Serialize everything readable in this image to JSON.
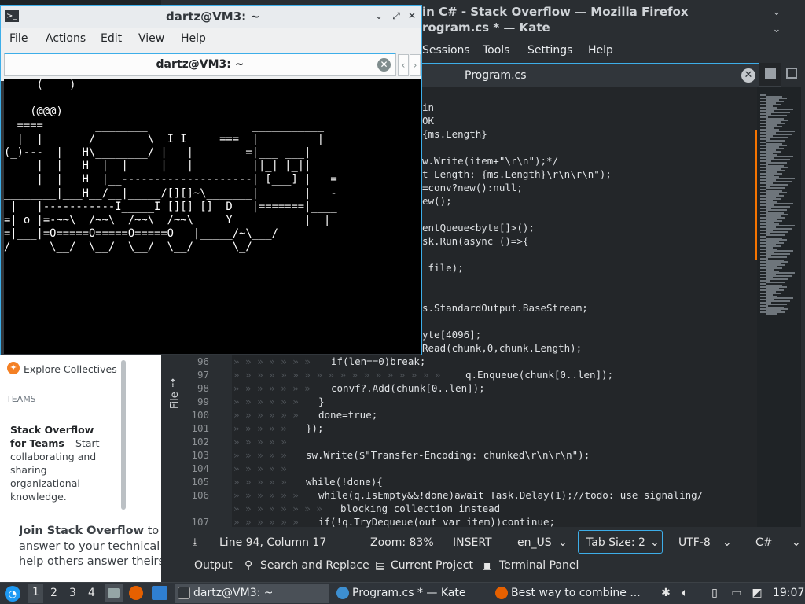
{
  "kate": {
    "title_line1": "in C# - Stack Overflow — Mozilla Firefox",
    "title_line2": "rogram.cs * — Kate",
    "menu": [
      "Sessions",
      "Tools",
      "Settings",
      "Help"
    ],
    "tab_label": "Program.cs",
    "side_tab": "File",
    "code_lines": [
      {
        "n": "",
        "t": "in"
      },
      {
        "n": "",
        "t": "OK"
      },
      {
        "n": "",
        "t": "{ms.Length}"
      },
      {
        "n": "",
        "t": ""
      },
      {
        "n": "",
        "t": "w.Write(item+\"\\r\\n\");*/"
      },
      {
        "n": "",
        "t": "t-Length: {ms.Length}\\r\\n\\r\\n\");"
      },
      {
        "n": "",
        "t": "=conv?new():null;"
      },
      {
        "n": "",
        "t": "ew();"
      },
      {
        "n": "",
        "t": ""
      },
      {
        "n": "",
        "t": "entQueue<byte[]>();"
      },
      {
        "n": "",
        "t": "sk.Run(async ()=>{"
      },
      {
        "n": "",
        "t": ""
      },
      {
        "n": "",
        "t": " file);"
      },
      {
        "n": "",
        "t": ""
      },
      {
        "n": "",
        "t": ""
      },
      {
        "n": "",
        "t": "s.StandardOutput.BaseStream;"
      },
      {
        "n": "",
        "t": ""
      },
      {
        "n": "",
        "t": "yte[4096];"
      },
      {
        "n": "",
        "t": "Read(chunk,0,chunk.Length);"
      }
    ],
    "numbered_lines": [
      {
        "n": "96",
        "t": "if(len==0)break;"
      },
      {
        "n": "97",
        "t": "q.Enqueue(chunk[0..len]);"
      },
      {
        "n": "98",
        "t": "convf?.Add(chunk[0..len]);"
      },
      {
        "n": "99",
        "t": "}"
      },
      {
        "n": "100",
        "t": "done=true;"
      },
      {
        "n": "101",
        "t": "});"
      },
      {
        "n": "102",
        "t": ""
      },
      {
        "n": "103",
        "t": "sw.Write($\"Transfer-Encoding: chunked\\r\\n\\r\\n\");"
      },
      {
        "n": "104",
        "t": ""
      },
      {
        "n": "105",
        "t": "while(!done){"
      },
      {
        "n": "106",
        "t": "while(q.IsEmpty&&!done)await Task.Delay(1);//todo: use signaling/"
      },
      {
        "n": "",
        "t": "blocking collection instead"
      },
      {
        "n": "107",
        "t": "if(!q.TryDequeue(out var item))continue;"
      }
    ],
    "status": {
      "position": "Line 94, Column 17",
      "zoom": "Zoom: 83%",
      "mode": "INSERT",
      "dictionary": "en_US",
      "tab_size": "Tab Size: 2",
      "encoding": "UTF-8",
      "language": "C#"
    },
    "toolviews": [
      "Output",
      "Search and Replace",
      "Current Project",
      "Terminal Panel"
    ]
  },
  "browser": {
    "explore": "Explore Collectives",
    "teams_header": "TEAMS",
    "promo_bold": "Stack Overflow for Teams",
    "promo_rest": " – Start collaborating and sharing organizational knowledge.",
    "join_bold": "Join Stack Overflow",
    "join_rest_1": " to fin",
    "join_line2": "answer to your technical qu",
    "join_line3": "help others answer theirs."
  },
  "terminal": {
    "title": "dartz@VM3: ~",
    "menu": [
      "File",
      "Actions",
      "Edit",
      "View",
      "Help"
    ],
    "tab_label": "dartz@VM3: ~",
    "ascii": [
      "     (    )",
      "",
      "    (@@@)",
      "  ====        ________                ___________",
      " _|  |_______/        \\__I_I_____===__|_________|",
      "(_)---  |   H\\________/ |   |        =|___ ___|",
      "     |  |   H  |  |     |   |         ||_| |_||",
      "     |  |   H  |__--------------------| [___] |   =",
      "________|___H__/__|_____/[][]~\\_______|       |   -",
      " |   |-----------I_____I [][] []  D   |=======|____",
      "=| o |=-~~\\  /~~\\  /~~\\  /~~\\ ____Y___________|__|_",
      "=|___|=O=====O=====O=====O   |_____/~\\___/",
      "/      \\__/  \\__/  \\__/  \\__/      \\_/"
    ]
  },
  "taskbar": {
    "workspaces": [
      "1",
      "2",
      "3",
      "4"
    ],
    "apps": [
      "dartz@VM3: ~",
      "Program.cs * — Kate",
      "Best way to combine ..."
    ],
    "clock": "19:07"
  },
  "colors": {
    "accent": "#3daee9",
    "panel": "#2f343a",
    "editor_bg": "#232629"
  }
}
